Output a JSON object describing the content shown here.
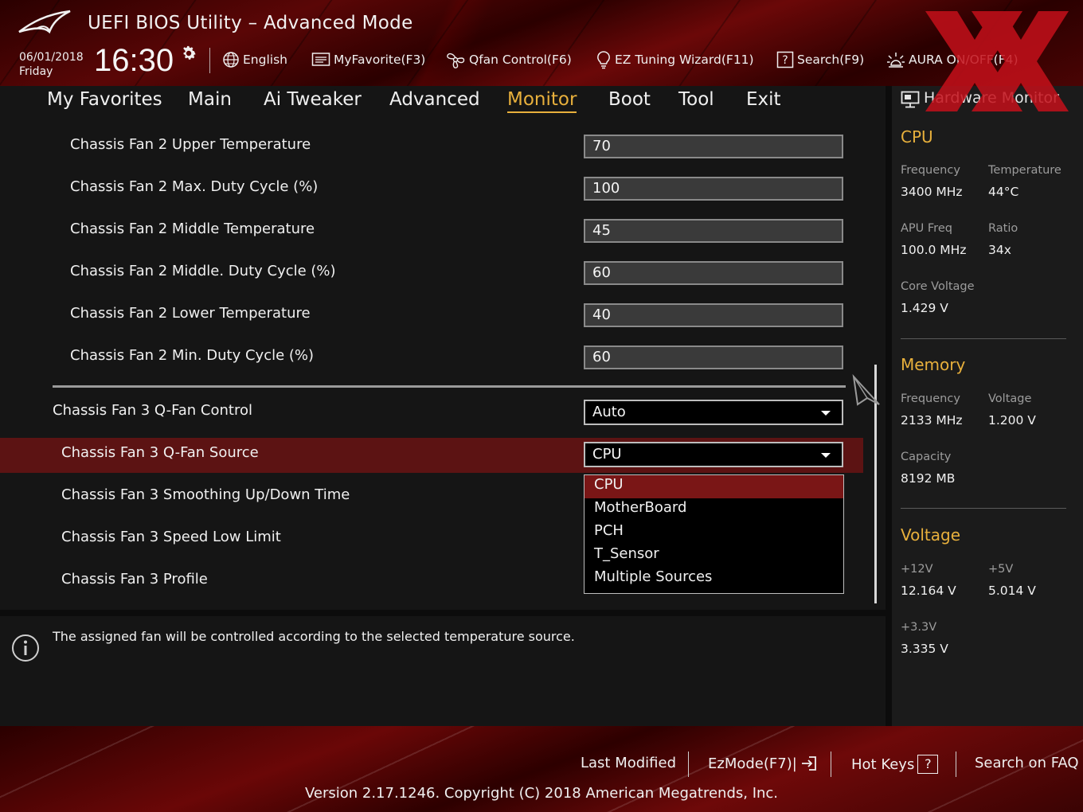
{
  "header": {
    "title": "UEFI BIOS Utility – Advanced Mode",
    "date": "06/01/2018",
    "day": "Friday",
    "time": "16:30",
    "tools": [
      {
        "label": "English",
        "icon": "globe-icon"
      },
      {
        "label": "MyFavorite(F3)",
        "icon": "favorite-list-icon"
      },
      {
        "label": "Qfan Control(F6)",
        "icon": "fan-icon"
      },
      {
        "label": "EZ Tuning Wizard(F11)",
        "icon": "lightbulb-icon"
      },
      {
        "label": "Search(F9)",
        "icon": "help-box-icon"
      },
      {
        "label": "AURA ON/OFF(F4)",
        "icon": "aura-light-icon"
      }
    ]
  },
  "nav": {
    "tabs": [
      "My Favorites",
      "Main",
      "Ai Tweaker",
      "Advanced",
      "Monitor",
      "Boot",
      "Tool",
      "Exit"
    ],
    "active": "Monitor"
  },
  "main": {
    "fan2_settings": [
      {
        "label": "Chassis Fan 2 Upper Temperature",
        "value": "70"
      },
      {
        "label": "Chassis Fan 2 Max. Duty Cycle (%)",
        "value": "100"
      },
      {
        "label": "Chassis Fan 2 Middle Temperature",
        "value": "45"
      },
      {
        "label": "Chassis Fan 2 Middle. Duty Cycle (%)",
        "value": "60"
      },
      {
        "label": "Chassis Fan 2 Lower Temperature",
        "value": "40"
      },
      {
        "label": "Chassis Fan 2 Min. Duty Cycle (%)",
        "value": "60"
      }
    ],
    "fan3_control": {
      "label": "Chassis Fan 3 Q-Fan Control",
      "value": "Auto"
    },
    "fan3_source": {
      "label": "Chassis Fan 3 Q-Fan Source",
      "value": "CPU"
    },
    "fan3_smoothing": {
      "label": "Chassis Fan 3 Smoothing Up/Down Time"
    },
    "fan3_low_limit": {
      "label": "Chassis Fan 3 Speed Low Limit"
    },
    "fan3_profile": {
      "label": "Chassis Fan 3 Profile"
    },
    "dropdown_options": [
      "CPU",
      "MotherBoard",
      "PCH",
      "T_Sensor",
      "Multiple Sources"
    ],
    "dropdown_selected": "CPU"
  },
  "info": {
    "text": "The assigned fan will be controlled according to the selected temperature source."
  },
  "hardware_monitor": {
    "title": "Hardware Monitor",
    "cpu": {
      "heading": "CPU",
      "frequency_label": "Frequency",
      "frequency": "3400 MHz",
      "temperature_label": "Temperature",
      "temperature": "44°C",
      "apu_freq_label": "APU Freq",
      "apu_freq": "100.0 MHz",
      "ratio_label": "Ratio",
      "ratio": "34x",
      "core_voltage_label": "Core Voltage",
      "core_voltage": "1.429 V"
    },
    "memory": {
      "heading": "Memory",
      "frequency_label": "Frequency",
      "frequency": "2133 MHz",
      "voltage_label": "Voltage",
      "voltage": "1.200 V",
      "capacity_label": "Capacity",
      "capacity": "8192 MB"
    },
    "voltage": {
      "heading": "Voltage",
      "v12_label": "+12V",
      "v12": "12.164 V",
      "v5_label": "+5V",
      "v5": "5.014 V",
      "v33_label": "+3.3V",
      "v33": "3.335 V"
    }
  },
  "footer": {
    "last_modified": "Last Modified",
    "ezmode": "EzMode(F7)|",
    "hot_keys": "Hot Keys",
    "hot_keys_badge": "?",
    "search_faq": "Search on FAQ",
    "version": "Version 2.17.1246. Copyright (C) 2018 American Megatrends, Inc."
  },
  "colors": {
    "accent": "#e8b03c",
    "highlight_row": "#5c1313",
    "dropdown_selected": "#7a1616",
    "panel_bg": "#151515"
  }
}
